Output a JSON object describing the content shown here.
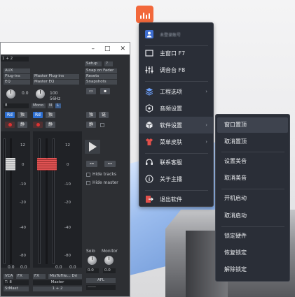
{
  "tray": {
    "icon": "bar-chart-icon",
    "color": "#f2683b"
  },
  "mixer": {
    "titlebar_buttons": [
      "–",
      "□",
      "✕"
    ],
    "routing": "1 + 2",
    "aux": "AUX",
    "plugins": "Plug-ins",
    "eq": "EQ",
    "master_plugins": "Master Plug-ins",
    "master_eq": "Master EQ",
    "setup": "Setup",
    "help": "?",
    "snap_fader": "Snap on Fader",
    "resets": "Resets",
    "snapshots": "Snapshots",
    "knob_val_left": "0.0",
    "knob_val_right": "100",
    "knob_sub": "56Hz",
    "ch_num": "8",
    "mono": "Mono",
    "n": "N",
    "l": "L",
    "rd": "Rd",
    "solo_cn": "独",
    "mute_cn": "静",
    "mute_cn2": "静",
    "solo_cn2": "独",
    "master_solo": "独",
    "master_mute": "静",
    "master_link": "链",
    "scale_left": [
      "12",
      "0",
      "-10",
      "-20",
      "-40",
      "-80"
    ],
    "scale_mid": [
      "12",
      "0",
      "-10",
      "-20",
      "-40",
      "-80"
    ],
    "val_left": "0.0",
    "val_mid": "0.0",
    "val_right": "0.0",
    "vca": "VCA",
    "fx_left": "FX",
    "fx_mid": "FX",
    "mixto": "MixToFile... Dri",
    "bus_label": "T: 8",
    "master_label": "Master",
    "bottom_left": "StMast",
    "bottom_mid": "1 + 2",
    "hide_tracks": "Hide tracks",
    "hide_master": "Hide master",
    "solo": "Solo",
    "monitor": "Monitor",
    "solo_val": "0.0",
    "monitor_val": "0.0",
    "afl": "AFL",
    "bottom_right": "------"
  },
  "menu": {
    "header": "未登录账号",
    "items": [
      {
        "label": "主窗口 F7",
        "icon": "window-icon",
        "has_submenu": false
      },
      {
        "label": "调音台 F8",
        "icon": "sliders-icon",
        "has_submenu": false
      },
      {
        "label": "工程选项",
        "icon": "layers-icon",
        "has_submenu": true
      },
      {
        "label": "音频设置",
        "icon": "settings-hex-icon",
        "has_submenu": false
      },
      {
        "label": "软件设置",
        "icon": "cube-icon",
        "has_submenu": true
      },
      {
        "label": "菜单皮肤",
        "icon": "shirt-icon",
        "has_submenu": true
      },
      {
        "label": "联系客服",
        "icon": "headset-icon",
        "has_submenu": false
      },
      {
        "label": "关于主播",
        "icon": "info-icon",
        "has_submenu": false
      },
      {
        "label": "退出软件",
        "icon": "exit-icon",
        "has_submenu": false
      }
    ]
  },
  "submenu": {
    "items": [
      "窗口置顶",
      "取消置顶",
      "设置美音",
      "取消美音",
      "开机启动",
      "取消启动",
      "锁定硬件",
      "恢复锁定",
      "解除锁定"
    ],
    "highlighted_index": 0
  }
}
